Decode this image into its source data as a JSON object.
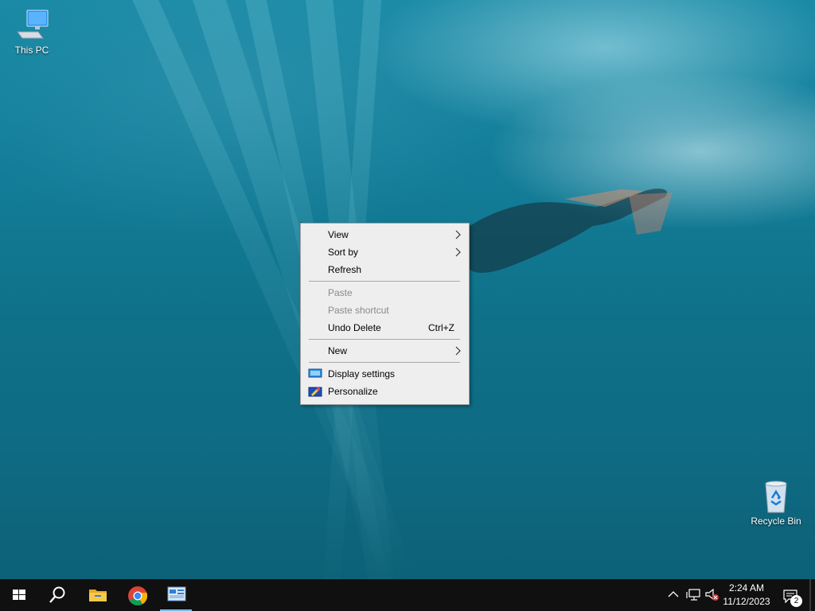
{
  "desktop": {
    "icons": [
      {
        "label": "This PC",
        "icon": "computer-icon"
      },
      {
        "label": "Recycle Bin",
        "icon": "recycle-bin-icon"
      }
    ]
  },
  "context_menu": {
    "items": [
      {
        "label": "View",
        "submenu": true,
        "enabled": true
      },
      {
        "label": "Sort by",
        "submenu": true,
        "enabled": true
      },
      {
        "label": "Refresh",
        "enabled": true
      },
      {
        "label": "Paste",
        "enabled": false
      },
      {
        "label": "Paste shortcut",
        "enabled": false
      },
      {
        "label": "Undo Delete",
        "shortcut": "Ctrl+Z",
        "enabled": true
      },
      {
        "label": "New",
        "submenu": true,
        "enabled": true
      },
      {
        "label": "Display settings",
        "icon": "display-settings-icon",
        "enabled": true
      },
      {
        "label": "Personalize",
        "icon": "personalize-icon",
        "enabled": true
      }
    ]
  },
  "taskbar": {
    "buttons": [
      {
        "name": "start",
        "icon": "windows-logo-icon"
      },
      {
        "name": "search",
        "icon": "search-icon"
      },
      {
        "name": "file-explorer",
        "icon": "folder-icon"
      },
      {
        "name": "chrome",
        "icon": "chrome-icon"
      },
      {
        "name": "control-panel",
        "icon": "control-panel-icon",
        "active": true
      }
    ],
    "tray": {
      "time": "2:24 AM",
      "date": "11/12/2023",
      "notification_count": "2"
    }
  },
  "colors": {
    "taskbar_bg": "#101010",
    "menu_bg": "#eeeeee",
    "active_indicator": "#76b9ed"
  }
}
